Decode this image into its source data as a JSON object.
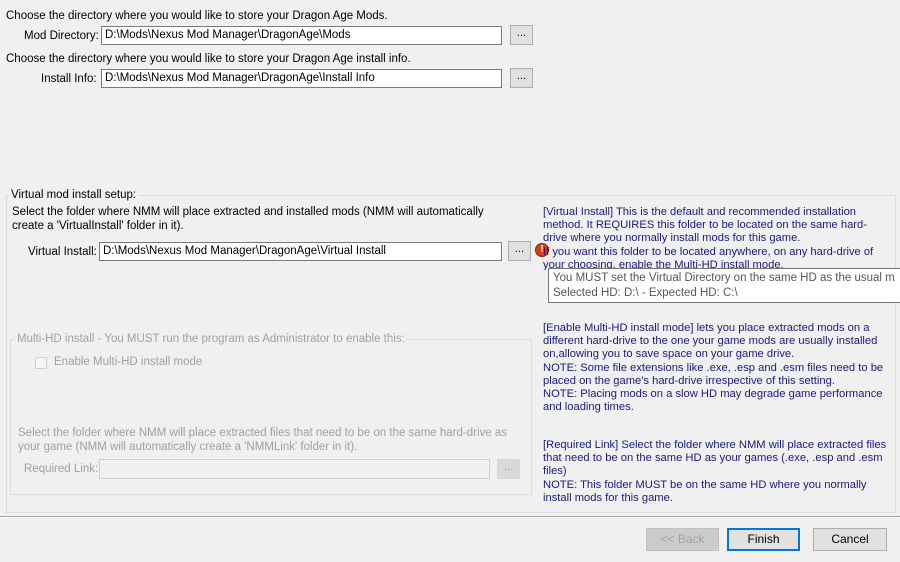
{
  "mods": {
    "prompt": "Choose the directory where you would like to store your Dragon Age Mods.",
    "label": "Mod Directory:",
    "value": "D:\\Mods\\Nexus Mod Manager\\DragonAge\\Mods",
    "browse": "..."
  },
  "install_info": {
    "prompt": "Choose the directory where you would like to store your Dragon Age install info.",
    "label": "Install Info:",
    "value": "D:\\Mods\\Nexus Mod Manager\\DragonAge\\Install Info",
    "browse": "..."
  },
  "virtual": {
    "group_title": "Virtual mod install setup:",
    "prompt": "Select the folder where NMM will place extracted and installed mods (NMM will automatically create a 'VirtualInstall' folder in it).",
    "label": "Virtual Install:",
    "value": "D:\\Mods\\Nexus Mod Manager\\DragonAge\\Virtual Install",
    "browse": "...",
    "error_icon": "error-icon",
    "info": "[Virtual Install] This is the default and recommended installation method. It REQUIRES this folder to be located on the same hard-drive where you normally install mods for this game.\nIf you want this folder to be located anywhere, on any hard-drive of your choosing, enable the Multi-HD install mode."
  },
  "tooltip": {
    "line1": "You MUST set the Virtual Directory on the same HD as the usual m",
    "line2": "Selected HD: D:\\ - Expected HD: C:\\"
  },
  "multi_hd": {
    "group_title": "Multi-HD install - You MUST run the program as Administrator to enable this:",
    "checkbox_label": "Enable Multi-HD install mode",
    "checked": false,
    "info": "[Enable Multi-HD install mode] lets you place extracted mods on a different hard-drive to the one your game mods are usually installed on,allowing you to save space on your game drive.\nNOTE: Some file extensions like .exe, .esp and .esm files need to be placed on the game's hard-drive irrespective of this setting.\nNOTE: Placing mods on a slow HD may degrade game performance and loading times."
  },
  "required_link": {
    "prompt": "Select the folder where NMM will place extracted files that need to be on the same hard-drive as your game (NMM will automatically create a 'NMMLink' folder in it).",
    "label": "Required Link:",
    "value": "",
    "browse": "...",
    "info": "[Required Link] Select the folder where NMM will place extracted files that need to be on the same HD as your games (.exe, .esp and .esm files)\nNOTE: This folder MUST be on the same HD where you normally install mods for this game."
  },
  "footer": {
    "back": "<< Back",
    "finish": "Finish",
    "cancel": "Cancel"
  }
}
